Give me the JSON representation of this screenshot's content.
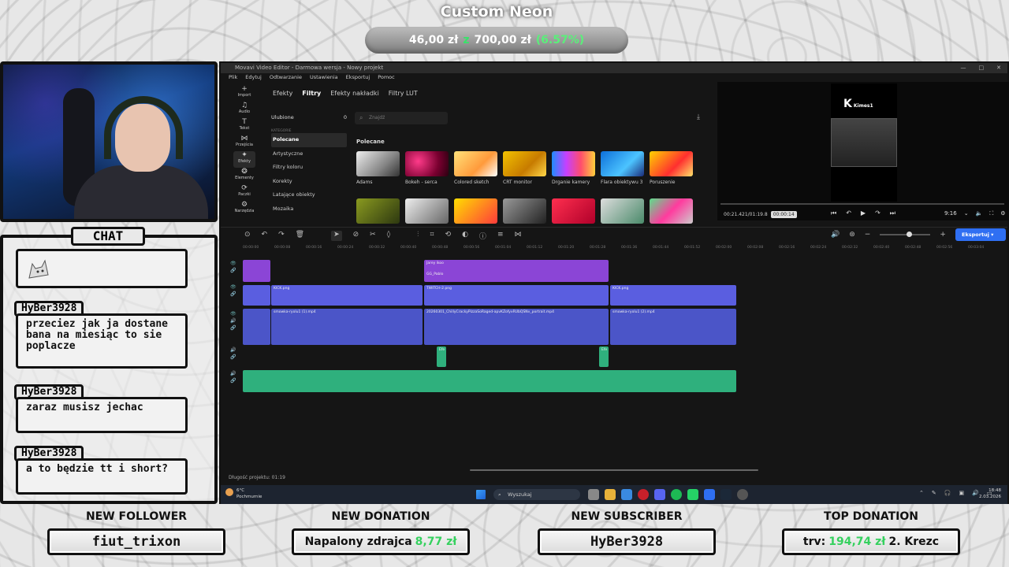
{
  "goal": {
    "title": "Custom Neon",
    "current": "46,00 zł",
    "sep": "z",
    "target": "700,00 zł",
    "percent": "(6.57%)"
  },
  "chat": {
    "label": "CHAT",
    "messages": [
      {
        "user": "HyBer3928",
        "text": "przeciez jak ja dostane bana na miesiąc to sie poplacze"
      },
      {
        "user": "HyBer3928",
        "text": "zaraz musisz jechac"
      },
      {
        "user": "HyBer3928",
        "text": "a to będzie tt i short?"
      }
    ]
  },
  "editor": {
    "title": "Movavi Video Editor - Darmowa wersja - Nowy projekt",
    "menu": [
      "Plik",
      "Edytuj",
      "Odtwarzanie",
      "Ustawienia",
      "Eksportuj",
      "Pomoc"
    ],
    "sidebar": [
      {
        "icon": "+",
        "label": "Import"
      },
      {
        "icon": "♫",
        "label": "Audio"
      },
      {
        "icon": "T",
        "label": "Tekst"
      },
      {
        "icon": "⋈",
        "label": "Przejścia"
      },
      {
        "icon": "✦",
        "label": "Efekty"
      },
      {
        "icon": "❂",
        "label": "Elementy"
      },
      {
        "icon": "⟳",
        "label": "Paczki"
      },
      {
        "icon": "⚙",
        "label": "Narzędzia"
      }
    ],
    "tabs": [
      "Efekty",
      "Filtry",
      "Efekty nakładki",
      "Filtry LUT"
    ],
    "active_tab": "Filtry",
    "favorites": {
      "label": "Ulubione",
      "count": "0"
    },
    "categories_header": "KATEGORIE",
    "categories": [
      "Polecane",
      "Artystyczne",
      "Filtry koloru",
      "Korekty",
      "Latające obiekty",
      "Mozaika"
    ],
    "search_placeholder": "Znajdź",
    "grid_header": "Polecane",
    "filters": [
      "Adams",
      "Bokeh - serca",
      "Colored sketch",
      "CRT monitor",
      "Drganie kamery",
      "Flara obiektywu 3",
      "Poruszenie"
    ],
    "preview": {
      "logo": "K",
      "logo_sub": "Kimes1",
      "time": "00:21.421/01:19.8",
      "tooltip": "00:00:14",
      "ratio": "9:16"
    },
    "export_label": "Eksportuj",
    "ruler": [
      "00:00:00",
      "00:00:08",
      "00:00:16",
      "00:00:24",
      "00:00:32",
      "00:00:40",
      "00:00:48",
      "00:00:56",
      "00:01:04",
      "00:01:12",
      "00:01:20",
      "00:01:28",
      "00:01:36",
      "00:01:44",
      "00:01:52",
      "00:02:00",
      "00:02:08",
      "00:02:16",
      "00:02:24",
      "00:02:32",
      "00:02:40",
      "00:02:48",
      "00:02:56",
      "00:03:04"
    ],
    "clips": {
      "title_clip": "Jarey ikoo",
      "title_clip2": "GG_Pablo",
      "kick1": "KICK.png",
      "twitch": "TWITCH-2.png",
      "kick2": "KICK.png",
      "vid1": "smowka-ryolu1 (1).mp4",
      "vid2": "20260301_ChillyCrackyPizzaSoRaged-apvKZofyxRUbQSNv_portrait.mp4",
      "vid3": "smowka-ryolu1 (2).mp4",
      "eff": "Efe"
    },
    "project_length": "Długość projektu: 01:19"
  },
  "taskbar": {
    "temp": "6°C",
    "weather": "Pochmurnie",
    "search": "Wyszukaj",
    "time": "18:48",
    "date": "2.03.2026"
  },
  "widgets": {
    "follower": {
      "title": "NEW FOLLOWER",
      "value": "fiut_trixon"
    },
    "donation": {
      "title": "NEW DONATION",
      "name": "Napalony zdrajca",
      "amount": "8,77 zł"
    },
    "subscriber": {
      "title": "NEW SUBSCRIBER",
      "value": "HyBer3928"
    },
    "top": {
      "title": "TOP DONATION",
      "prefix": "trv:",
      "amount": "194,74 zł",
      "suffix": "2. Krezc"
    }
  }
}
